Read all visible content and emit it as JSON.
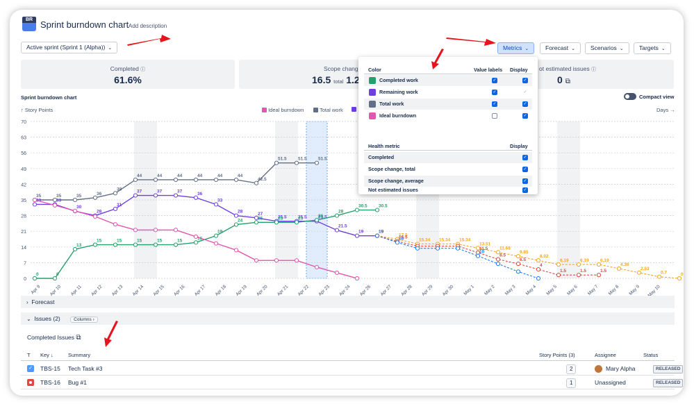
{
  "header": {
    "logo_text": "BR",
    "title": "Sprint burndown chart",
    "add_description": "Add description"
  },
  "toolbar": {
    "sprint_select": "Active sprint (Sprint 1 (Alpha))",
    "metrics": "Metrics",
    "forecast": "Forecast",
    "scenarios": "Scenarios",
    "targets": "Targets"
  },
  "cards": {
    "completed_label": "Completed",
    "completed_value": "61.6%",
    "scope_label": "Scope chang",
    "scope_value": "16.5",
    "scope_total": "total",
    "scope_value2": "1.2",
    "not_estimated_label": "ot estimated issues",
    "not_estimated_value": "0"
  },
  "chart": {
    "title": "Sprint burndown chart",
    "y_label": "Story Points",
    "x_label": "Days",
    "compact_view": "Compact view",
    "legend": [
      "Ideal burndown",
      "Total work"
    ]
  },
  "metrics_popup": {
    "header_color": "Color",
    "header_value_labels": "Value labels",
    "header_display": "Display",
    "rows": [
      {
        "label": "Completed work",
        "color": "#22a06b"
      },
      {
        "label": "Remaining work",
        "color": "#6e3ee3"
      },
      {
        "label": "Total work",
        "color": "#626f86"
      },
      {
        "label": "Ideal burndown",
        "color": "#e356b0"
      }
    ],
    "health_header": "Health metric",
    "health_display": "Display",
    "health_rows": [
      "Completed",
      "Scope change, total",
      "Scope change, average",
      "Not estimated issues"
    ]
  },
  "sections": {
    "forecast": "Forecast",
    "issues": "Issues (2)",
    "columns": "Columns"
  },
  "issues": {
    "completed_title": "Completed Issues",
    "headers": {
      "t": "T",
      "key": "Key",
      "summary": "Summary",
      "points": "Story Points (3)",
      "assignee": "Assignee",
      "status": "Status"
    },
    "rows": [
      {
        "key": "TBS-15",
        "summary": "Tech Task #3",
        "points": "2",
        "assignee": "Mary Alpha",
        "status": "RELEASED"
      },
      {
        "key": "TBS-16",
        "summary": "Bug #1",
        "points": "1",
        "assignee": "Unassigned",
        "status": "RELEASED"
      }
    ]
  },
  "chart_data": {
    "type": "line",
    "title": "Sprint burndown chart",
    "ylabel": "Story Points",
    "xlabel": "Days",
    "ylim": [
      0,
      70
    ],
    "yticks": [
      0,
      7,
      14,
      21,
      28,
      35,
      42,
      49,
      56,
      63,
      70
    ],
    "categories": [
      "Apr 9",
      "Apr 10",
      "Apr 11",
      "Apr 12",
      "Apr 13",
      "Apr 14",
      "Apr 15",
      "Apr 16",
      "Apr 17",
      "Apr 18",
      "Apr 19",
      "Apr 20",
      "Apr 21",
      "Apr 22",
      "Apr 23",
      "Apr 24",
      "Apr 25",
      "Apr 26",
      "Apr 27",
      "Apr 28",
      "Apr 29",
      "Apr 30",
      "May 1",
      "May 2",
      "May 3",
      "May 4",
      "May 5",
      "May 6",
      "May 7",
      "May 8",
      "May 9",
      "May 10",
      "May 11"
    ],
    "xtick_labels": [
      "Apr 9",
      "Apr 10",
      "Apr 11",
      "Apr 12",
      "Apr 13",
      "Apr 14",
      "Apr 15",
      "Apr 16",
      "Apr 17",
      "Apr 18",
      "Apr 19",
      "Apr 20",
      "Apr 21",
      "Apr 22",
      "Apr 23",
      "Apr 24",
      "Apr 26",
      "Apr 27",
      "Apr 28",
      "Apr 29",
      "Apr 30",
      "May 1",
      "May 2",
      "May 3",
      "May 4",
      "May 5",
      "May 6",
      "May 7",
      "May 8",
      "May 9",
      "May 10"
    ],
    "series": [
      {
        "name": "Total work",
        "color": "#626f86",
        "values": [
          35,
          35,
          35,
          36,
          38,
          44,
          44,
          44,
          44,
          44,
          44,
          42.5,
          51.5,
          51.5,
          51.5,
          null,
          null,
          null,
          null,
          null,
          null,
          null,
          null,
          null,
          null,
          null,
          null,
          null,
          null,
          null,
          null,
          null,
          null
        ],
        "labels": [
          "35",
          "35",
          "35",
          "36",
          "38",
          "44",
          "44",
          "44",
          "44",
          "44",
          "44",
          "42.5",
          "51.5",
          "51.5",
          "51.5"
        ]
      },
      {
        "name": "Remaining work",
        "color": "#6e3ee3",
        "values": [
          33,
          33,
          30,
          28,
          31,
          37,
          37,
          37,
          36,
          33,
          28,
          27,
          25.5,
          25.5,
          25.5,
          21.5,
          19,
          19,
          null,
          null,
          null,
          null,
          null,
          null,
          null,
          null,
          null,
          null,
          null,
          null,
          null,
          null,
          null
        ],
        "labels": [
          "33",
          "33",
          "30",
          "28",
          "31",
          "37",
          "37",
          "37",
          "36",
          "33",
          "28",
          "27",
          "25.5",
          "25.5",
          "25.5",
          "21.5",
          "19",
          "19"
        ]
      },
      {
        "name": "Completed work",
        "color": "#22a06b",
        "values": [
          0,
          0,
          13,
          15,
          15,
          15,
          15,
          15,
          16,
          19,
          24,
          25,
          25,
          25,
          26,
          28,
          30.5,
          30.5,
          null,
          null,
          null,
          null,
          null,
          null,
          null,
          null,
          null,
          null,
          null,
          null,
          null,
          null,
          null
        ],
        "labels": [
          "0",
          "0",
          "13",
          "15",
          "15",
          "15",
          "15",
          "15",
          "16",
          "19",
          "24",
          "25",
          "25",
          "25",
          "26",
          "28",
          "30.5",
          "30.5"
        ]
      },
      {
        "name": "Ideal burndown",
        "color": "#e356b0",
        "values": [
          35,
          32.6,
          30.1,
          27.6,
          24.1,
          21.6,
          21.6,
          21.6,
          18.6,
          15.6,
          12.6,
          8,
          8,
          8,
          5,
          2.5,
          0,
          null,
          null,
          null,
          null,
          null,
          null,
          null,
          null,
          null,
          null,
          null,
          null,
          null,
          null,
          null,
          null
        ]
      },
      {
        "name": "Forecast (orange)",
        "color": "#f5a623",
        "values": [
          null,
          null,
          null,
          null,
          null,
          null,
          null,
          null,
          null,
          null,
          null,
          null,
          null,
          null,
          null,
          null,
          null,
          19,
          17.5,
          15.34,
          15.34,
          15.34,
          13.51,
          11.68,
          9.85,
          8.02,
          6.19,
          6.19,
          6.19,
          4.36,
          2.53,
          0.7,
          0
        ],
        "labels": [
          "19",
          "17.5",
          "15.34",
          "15.34",
          "15.34",
          "13.51",
          "11.68",
          "9.85",
          "8.02",
          "6.19",
          "6.19",
          "6.19",
          "4.36",
          "2.53",
          "0.7",
          "0"
        ]
      },
      {
        "name": "Forecast (red)",
        "color": "#e2483d",
        "values": [
          null,
          null,
          null,
          null,
          null,
          null,
          null,
          null,
          null,
          null,
          null,
          null,
          null,
          null,
          null,
          null,
          null,
          19,
          16.5,
          14.4,
          14.4,
          14.4,
          11.5,
          8.5,
          6.5,
          4,
          1.5,
          1.5,
          1.5,
          null,
          null,
          null,
          null
        ],
        "labels": [
          "19",
          "16.5",
          "",
          "",
          "",
          "11.5",
          "8.5",
          "6.5",
          "4",
          "1.5",
          "1.5",
          "1.5"
        ]
      },
      {
        "name": "Forecast (blue)",
        "color": "#1d7afc",
        "values": [
          null,
          null,
          null,
          null,
          null,
          null,
          null,
          null,
          null,
          null,
          null,
          null,
          null,
          null,
          null,
          null,
          null,
          19,
          16,
          13.4,
          13.4,
          13.4,
          10,
          6.5,
          3,
          0,
          null,
          null,
          null,
          null,
          null,
          null,
          null
        ],
        "labels": [
          "19",
          "16",
          "",
          "",
          "",
          "10",
          "",
          "",
          "",
          ""
        ]
      }
    ],
    "weekend_bands": [
      [
        5,
        6
      ],
      [
        12,
        13
      ],
      [
        19,
        20
      ],
      [
        26,
        27
      ]
    ],
    "highlight_day": 14,
    "grid": true
  }
}
